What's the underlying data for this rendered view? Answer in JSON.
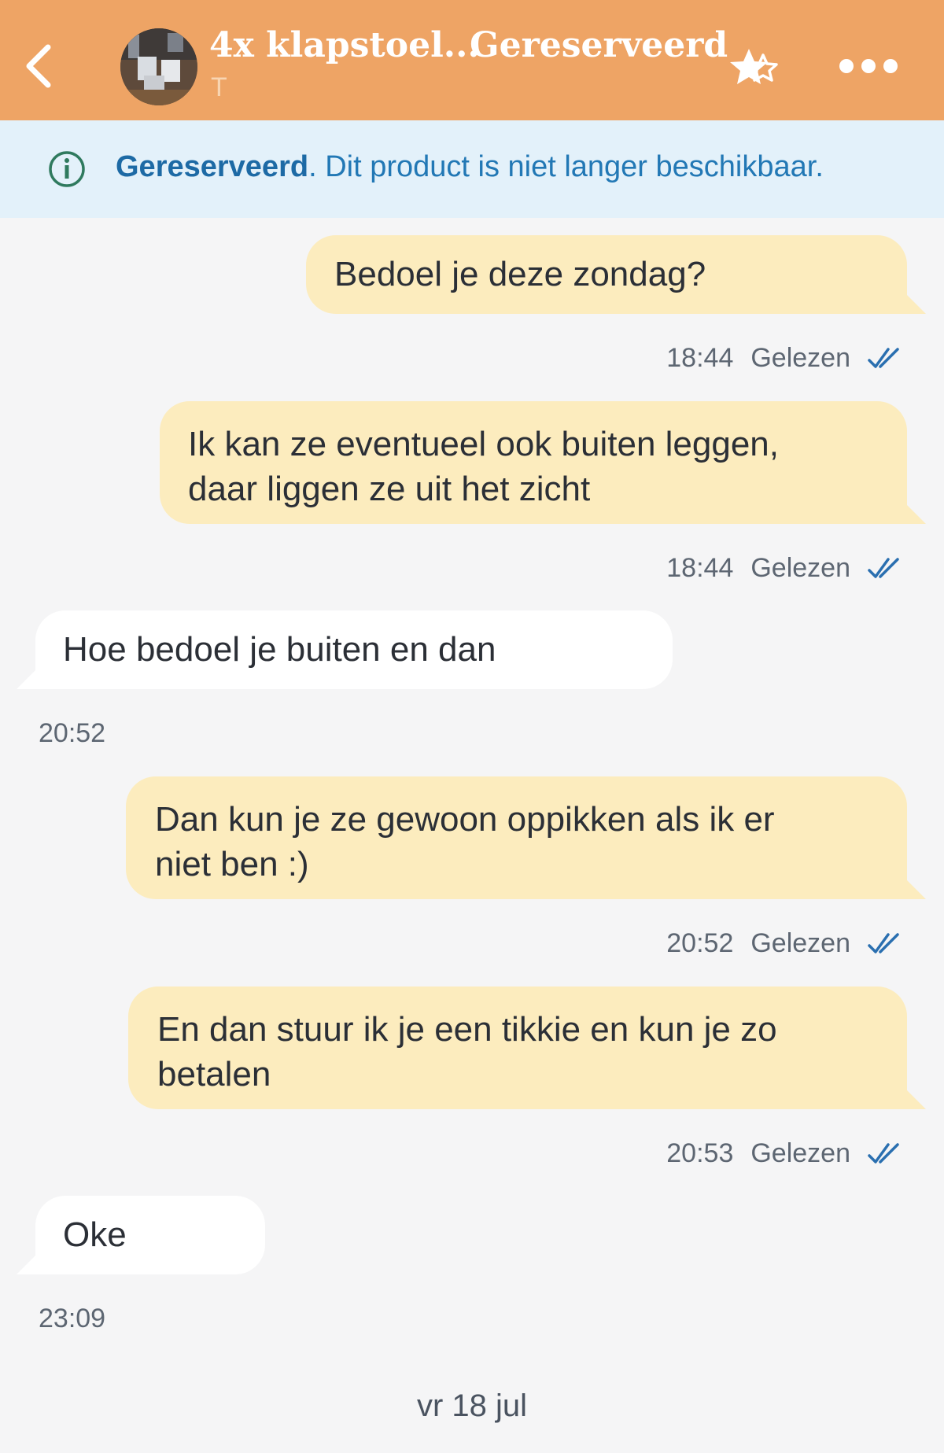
{
  "header": {
    "title": "4x klapstoel...",
    "status": "Gereserveerd",
    "subtitle": "T",
    "bg_color": "#eea465"
  },
  "banner": {
    "bold": "Gereserveerd",
    "text": ". Dit product is niet langer beschikbaar."
  },
  "messages": [
    {
      "dir": "out",
      "line1": "Bedoel je deze zondag?",
      "time": "18:44",
      "status": "Gelezen"
    },
    {
      "dir": "out",
      "line1": "Ik kan ze eventueel ook buiten leggen,",
      "line2": "daar liggen ze uit het zicht",
      "time": "18:44",
      "status": "Gelezen"
    },
    {
      "dir": "in",
      "line1": "Hoe bedoel je buiten en dan",
      "time": "20:52"
    },
    {
      "dir": "out",
      "line1": "Dan kun je ze gewoon oppikken als ik er",
      "line2": "niet ben :)",
      "time": "20:52",
      "status": "Gelezen"
    },
    {
      "dir": "out",
      "line1": "En dan stuur ik je een tikkie en kun je zo",
      "line2": "betalen",
      "time": "20:53",
      "status": "Gelezen"
    },
    {
      "dir": "in",
      "line1": "Oke",
      "time": "23:09"
    }
  ],
  "date_separator": "vr 18 jul",
  "icons": {
    "back": "chevron-left-icon",
    "favorite": "star-icon",
    "more": "more-horizontal-icon",
    "info": "info-circle-icon",
    "read": "double-check-icon"
  }
}
